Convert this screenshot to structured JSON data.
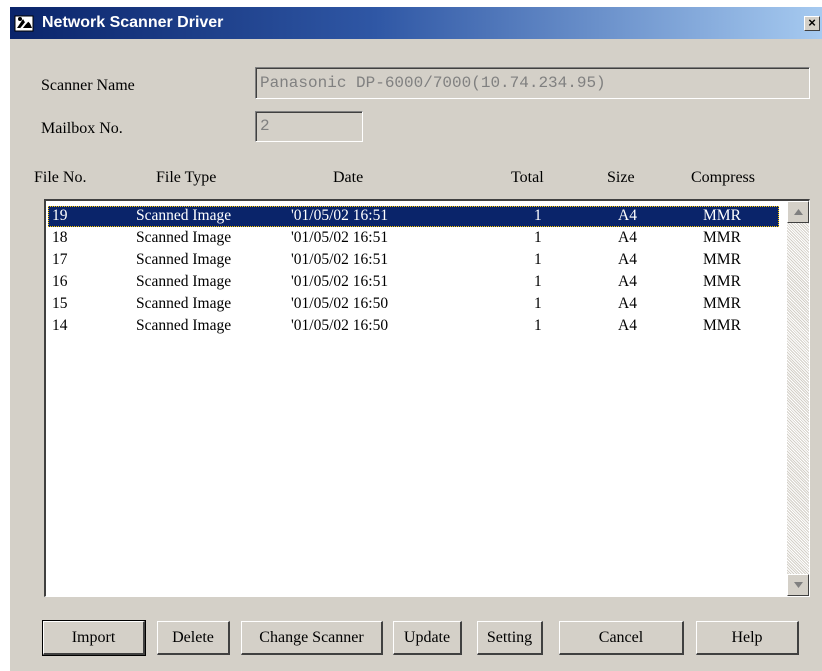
{
  "window": {
    "title": "Network Scanner Driver",
    "close_glyph": "×"
  },
  "scanner_name": {
    "label": "Scanner Name",
    "value": "Panasonic DP-6000/7000(10.74.234.95)"
  },
  "mailbox": {
    "label": "Mailbox No.",
    "value": "2"
  },
  "columns": [
    "File No.",
    "File Type",
    "Date",
    "Total",
    "Size",
    "Compress"
  ],
  "rows": [
    {
      "file_no": "19",
      "file_type": "Scanned Image",
      "date": "'01/05/02 16:51",
      "total": "1",
      "size": "A4",
      "compress": "MMR",
      "selected": true
    },
    {
      "file_no": "18",
      "file_type": "Scanned Image",
      "date": "'01/05/02 16:51",
      "total": "1",
      "size": "A4",
      "compress": "MMR",
      "selected": false
    },
    {
      "file_no": "17",
      "file_type": "Scanned Image",
      "date": "'01/05/02 16:51",
      "total": "1",
      "size": "A4",
      "compress": "MMR",
      "selected": false
    },
    {
      "file_no": "16",
      "file_type": "Scanned Image",
      "date": "'01/05/02 16:51",
      "total": "1",
      "size": "A4",
      "compress": "MMR",
      "selected": false
    },
    {
      "file_no": "15",
      "file_type": "Scanned Image",
      "date": "'01/05/02 16:50",
      "total": "1",
      "size": "A4",
      "compress": "MMR",
      "selected": false
    },
    {
      "file_no": "14",
      "file_type": "Scanned Image",
      "date": "'01/05/02 16:50",
      "total": "1",
      "size": "A4",
      "compress": "MMR",
      "selected": false
    }
  ],
  "buttons": {
    "import": "Import",
    "delete": "Delete",
    "change_scanner": "Change Scanner",
    "update": "Update",
    "setting": "Setting",
    "cancel": "Cancel",
    "help": "Help"
  },
  "icons": {
    "app": "scanner-app-icon",
    "close": "close-icon",
    "scroll_up": "scroll-up-arrow-icon",
    "scroll_down": "scroll-down-arrow-icon"
  },
  "colors": {
    "titlebar_start": "#0a246a",
    "titlebar_end": "#a6caf0",
    "selection": "#0a246a",
    "dialog_face": "#d4d0c8"
  }
}
